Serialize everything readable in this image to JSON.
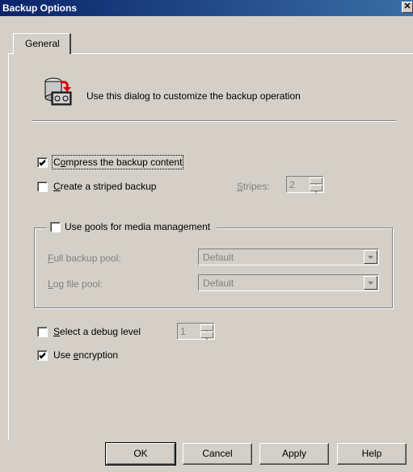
{
  "window": {
    "title": "Backup Options",
    "close_glyph": "✕"
  },
  "tabs": [
    {
      "label": "General"
    }
  ],
  "header": {
    "icon": "backup-tape-icon",
    "text": "Use this dialog to customize the backup operation"
  },
  "options": {
    "compress": {
      "prefix": "C",
      "accel": "o",
      "rest": "mpress the backup content",
      "checked": true
    },
    "striped": {
      "accel": "C",
      "rest": "reate a striped backup",
      "checked": false
    },
    "stripes": {
      "accel": "S",
      "rest": "tripes:",
      "value": "2"
    },
    "pools": {
      "prefix": "Use ",
      "accel": "p",
      "rest": "ools for media management",
      "checked": false
    },
    "full_pool": {
      "accel": "F",
      "rest": "ull backup pool:",
      "value": "Default"
    },
    "log_pool": {
      "accel": "L",
      "rest": "og file pool:",
      "value": "Default"
    },
    "debug": {
      "accel": "S",
      "rest": "elect a debug level",
      "checked": false,
      "value": "1"
    },
    "encryption": {
      "prefix": "Use ",
      "accel": "e",
      "rest": "ncryption",
      "checked": true
    }
  },
  "buttons": {
    "ok": "OK",
    "cancel": "Cancel",
    "apply": "Apply",
    "help": "Help"
  }
}
